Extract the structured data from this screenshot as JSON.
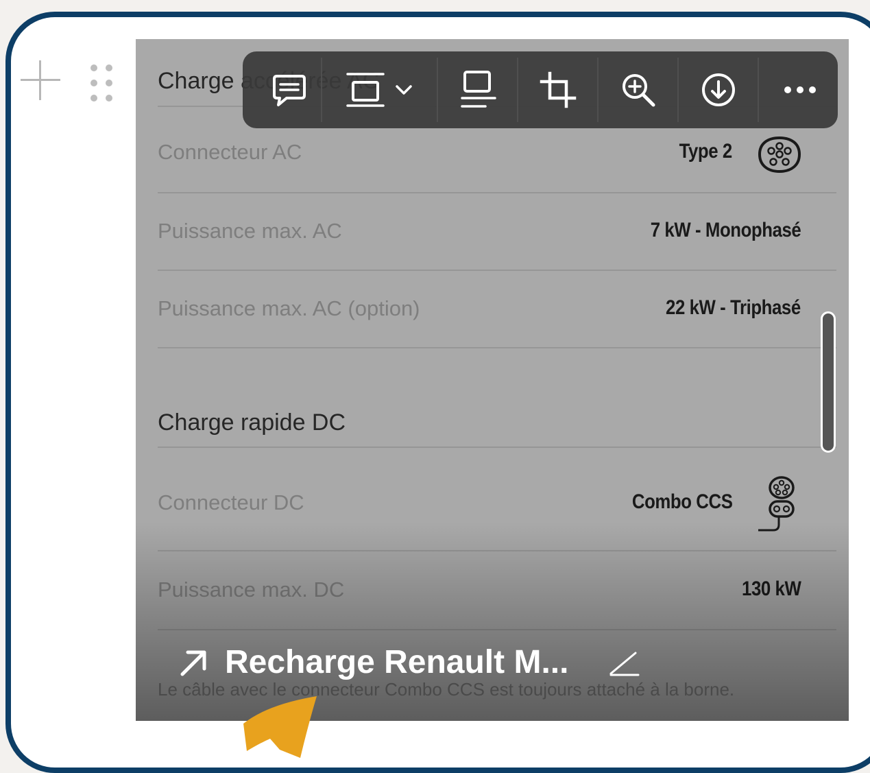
{
  "embed": {
    "section_ac": "Charge accélérée AC",
    "rows_ac": [
      {
        "label": "Connecteur AC",
        "value": "Type 2",
        "icon": "type2-connector-icon"
      },
      {
        "label": "Puissance max. AC",
        "value": "7 kW - Monophasé"
      },
      {
        "label": "Puissance max. AC (option)",
        "value": "22 kW - Triphasé"
      }
    ],
    "section_dc": "Charge rapide DC",
    "rows_dc": [
      {
        "label": "Connecteur DC",
        "value": "Combo CCS",
        "icon": "combo-ccs-connector-icon"
      },
      {
        "label": "Puissance max. DC",
        "value": "130 kW"
      }
    ],
    "caption": "Le câble avec le connecteur Combo CCS est toujours attaché à la borne.",
    "link_title": "Recharge Renault M..."
  },
  "toolbar": {
    "buttons": [
      {
        "name": "comment-button",
        "icon": "comment-icon"
      },
      {
        "name": "display-mode-dropdown",
        "icon": "embed-display-icon"
      },
      {
        "name": "caption-button",
        "icon": "caption-icon"
      },
      {
        "name": "crop-button",
        "icon": "crop-icon"
      },
      {
        "name": "zoom-button",
        "icon": "zoom-in-icon"
      },
      {
        "name": "download-button",
        "icon": "download-icon"
      },
      {
        "name": "more-button",
        "icon": "more-icon"
      }
    ]
  },
  "colors": {
    "frame_border": "#0d3e66",
    "embed_background": "#a9a9a9",
    "toolbar_background": "#3a3a3a",
    "pointer_arrow": "#e8a21e"
  }
}
